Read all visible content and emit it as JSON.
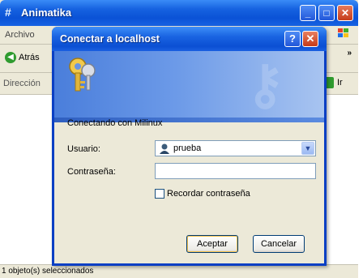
{
  "explorer": {
    "title": "Animatika",
    "menu_archivo": "Archivo",
    "back_label": "Atrás",
    "address_label": "Dirección",
    "go_label": "Ir",
    "status": "1 objeto(s) seleccionados",
    "toolbar_chevron": "»"
  },
  "dialog": {
    "title": "Conectar a localhost",
    "help_glyph": "?",
    "close_glyph": "✕",
    "connecting_text": "Conectando con Milinux",
    "user_label": "Usuario:",
    "user_value": "prueba",
    "password_label": "Contraseña:",
    "password_value": "",
    "remember_label": "Recordar contraseña",
    "remember_checked": false,
    "ok_label": "Aceptar",
    "cancel_label": "Cancelar"
  },
  "colors": {
    "titlebar": "#0a52d6",
    "dialog_border": "#0a3fc4",
    "window_bg": "#ece9d8"
  }
}
